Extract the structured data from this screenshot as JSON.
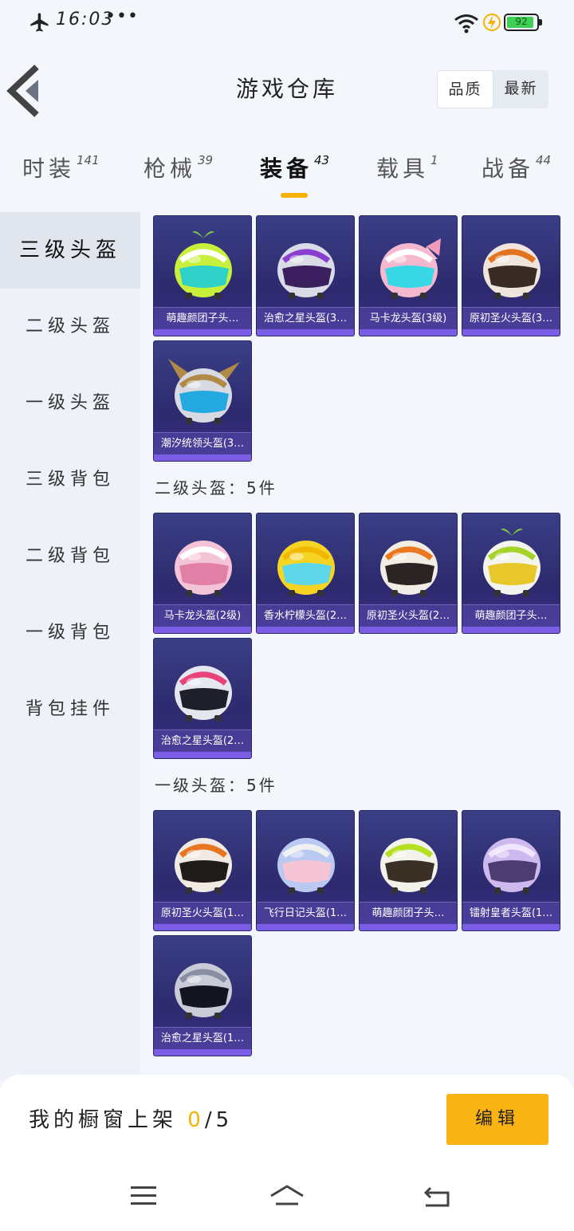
{
  "status": {
    "time": "16:03",
    "dots": "•••",
    "battery": "92",
    "battery_pct": 92
  },
  "header": {
    "title": "游戏仓库",
    "sort": [
      "品质",
      "最新"
    ]
  },
  "tabs": [
    {
      "label": "时装",
      "count": "141"
    },
    {
      "label": "枪械",
      "count": "39"
    },
    {
      "label": "装备",
      "count": "43"
    },
    {
      "label": "载具",
      "count": "1"
    },
    {
      "label": "战备",
      "count": "44"
    }
  ],
  "sidebar": [
    "三级头盔",
    "二级头盔",
    "一级头盔",
    "三级背包",
    "二级背包",
    "一级背包",
    "背包挂件"
  ],
  "sections": [
    {
      "title": "",
      "items": [
        {
          "name": "萌趣颜团子头…",
          "icon": "helmet-green-cartoon"
        },
        {
          "name": "治愈之星头盔(3…",
          "icon": "helmet-white-purple"
        },
        {
          "name": "马卡龙头盔(3级)",
          "icon": "helmet-pink-bow"
        },
        {
          "name": "原初圣火头盔(3…",
          "icon": "helmet-orange-visor"
        },
        {
          "name": "潮汐统领头盔(3…",
          "icon": "helmet-silver-fin"
        }
      ]
    },
    {
      "title": "二级头盔：5件",
      "items": [
        {
          "name": "马卡龙头盔(2级)",
          "icon": "helmet-pink-cap"
        },
        {
          "name": "香水柠檬头盔(2…",
          "icon": "helmet-yellow-goggles"
        },
        {
          "name": "原初圣火头盔(2…",
          "icon": "helmet-orange-white"
        },
        {
          "name": "萌趣颜团子头…",
          "icon": "helmet-white-sprout"
        },
        {
          "name": "治愈之星头盔(2…",
          "icon": "helmet-white-moto"
        }
      ]
    },
    {
      "title": "一级头盔：5件",
      "items": [
        {
          "name": "原初圣火头盔(1…",
          "icon": "helmet-orange-open"
        },
        {
          "name": "飞行日记头盔(1…",
          "icon": "helmet-blue-open"
        },
        {
          "name": "萌趣颜团子头…",
          "icon": "helmet-lime-open"
        },
        {
          "name": "镭射皇者头盔(1…",
          "icon": "helmet-lavender-open"
        },
        {
          "name": "治愈之星头盔(1…",
          "icon": "helmet-silver-full"
        }
      ]
    }
  ],
  "bottom": {
    "label": "我的橱窗上架",
    "current": "0",
    "total": "/5",
    "edit": "编辑"
  },
  "colors": {
    "accent": "#f5b200",
    "card_bg": "#2d2a6e",
    "card_bar": "#7c5ee6"
  }
}
